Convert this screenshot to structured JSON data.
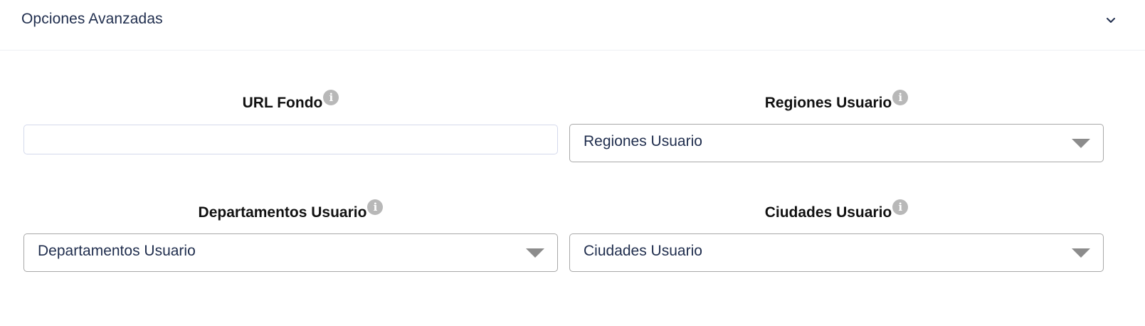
{
  "section": {
    "title": "Opciones Avanzadas",
    "toggle_icon": "chevron-down-icon"
  },
  "fields": {
    "url_fondo": {
      "label": "URL Fondo",
      "value": "",
      "placeholder": "",
      "info_icon": "info-icon"
    },
    "regiones": {
      "label": "Regiones Usuario",
      "selected": "Regiones Usuario",
      "info_icon": "info-icon"
    },
    "departamentos": {
      "label": "Departamentos Usuario",
      "selected": "Departamentos Usuario",
      "info_icon": "info-icon"
    },
    "ciudades": {
      "label": "Ciudades Usuario",
      "selected": "Ciudades Usuario",
      "info_icon": "info-icon"
    }
  },
  "info_glyph": "i",
  "colors": {
    "text": "#1f2d4d",
    "label": "#111111",
    "info_icon_bg": "#b8b8b8",
    "input_border": "#d4d9ec",
    "select_border": "#a8a8a8",
    "caret": "#8c8c8c"
  }
}
